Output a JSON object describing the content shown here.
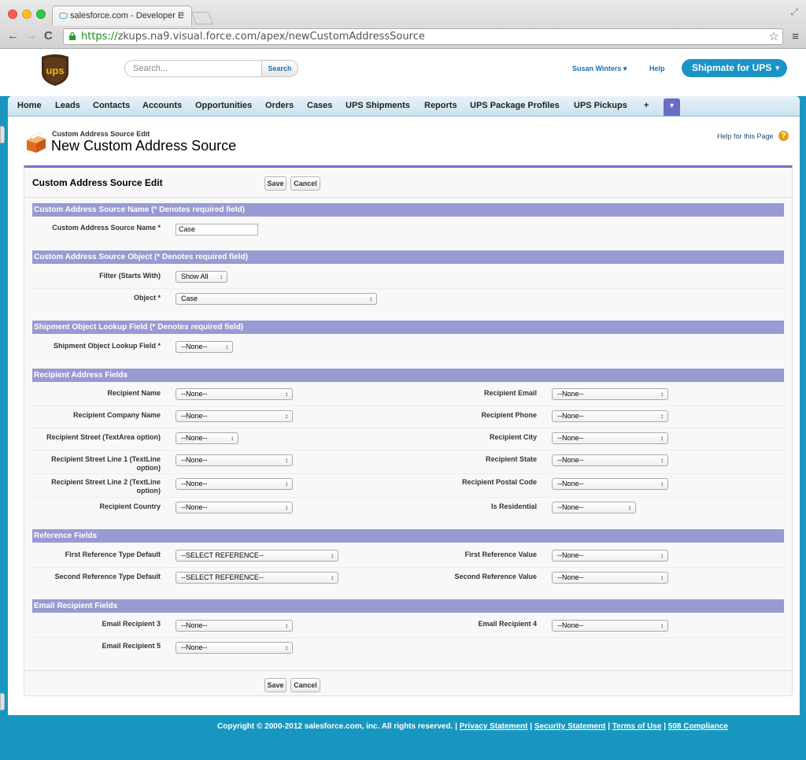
{
  "browser": {
    "tab_title": "salesforce.com - Developer E",
    "tab_close": "×",
    "url_scheme": "https://",
    "url_rest": "zkups.na9.visual.force.com/apex/newCustomAddressSource",
    "back": "←",
    "forward": "→",
    "reload": "C",
    "star": "☆",
    "menu": "≡",
    "resize": "⤢"
  },
  "header": {
    "search_placeholder": "Search...",
    "search_button": "Search",
    "user": "Susan Winters ▾",
    "help": "Help",
    "app_menu": "Shipmate for UPS",
    "app_caret": "▾"
  },
  "nav_tabs": [
    "Home",
    "Leads",
    "Contacts",
    "Accounts",
    "Opportunities",
    "Orders",
    "Cases",
    "UPS Shipments",
    "Reports",
    "UPS Package Profiles",
    "UPS Pickups",
    "+"
  ],
  "nav_more": "▾",
  "page": {
    "breadcrumb": "Custom Address Source Edit",
    "title": "New Custom Address Source",
    "help_link": "Help for this Page",
    "help_icon": "?"
  },
  "form": {
    "title": "Custom Address Source Edit",
    "save": "Save",
    "cancel": "Cancel",
    "sections": {
      "name": "Custom Address Source Name (* Denotes required field)",
      "object": "Custom Address Source Object (* Denotes required field)",
      "lookup": "Shipment Object Lookup Field (* Denotes required field)",
      "recipient": "Recipient Address Fields",
      "reference": "Reference Fields",
      "email": "Email Recipient Fields"
    },
    "name_label": "Custom Address Source Name *",
    "name_value": "Case",
    "filter_label": "Filter (Starts With)",
    "filter_value": "Show All",
    "object_label": "Object *",
    "object_value": "Case",
    "lookup_label": "Shipment Object Lookup Field *",
    "lookup_value": "--None--",
    "recipient_left": [
      {
        "label": "Recipient Name",
        "value": "--None--"
      },
      {
        "label": "Recipient Company Name",
        "value": "--None--"
      },
      {
        "label": "Recipient Street (TextArea option)",
        "value": "--None--"
      },
      {
        "label": "Recipient Street Line 1 (TextLine option)",
        "value": "--None--"
      },
      {
        "label": "Recipient Street Line 2 (TextLine option)",
        "value": "--None--"
      },
      {
        "label": "Recipient Country",
        "value": "--None--"
      }
    ],
    "recipient_right": [
      {
        "label": "Recipient Email",
        "value": "--None--"
      },
      {
        "label": "Recipient Phone",
        "value": "--None--"
      },
      {
        "label": "Recipient City",
        "value": "--None--"
      },
      {
        "label": "Recipient State",
        "value": "--None--"
      },
      {
        "label": "Recipient Postal Code",
        "value": "--None--"
      },
      {
        "label": "Is Residential",
        "value": "--None--"
      }
    ],
    "reference_left": [
      {
        "label": "First Reference Type Default",
        "value": "--SELECT REFERENCE--"
      },
      {
        "label": "Second Reference Type Default",
        "value": "--SELECT REFERENCE--"
      }
    ],
    "reference_right": [
      {
        "label": "First Reference Value",
        "value": "--None--"
      },
      {
        "label": "Second Reference Value",
        "value": "--None--"
      }
    ],
    "email_left": [
      {
        "label": "Email Recipient 3",
        "value": "--None--"
      },
      {
        "label": "Email Recipient 5",
        "value": "--None--"
      }
    ],
    "email_right": [
      {
        "label": "Email Recipient 4",
        "value": "--None--"
      }
    ]
  },
  "footer": {
    "copyright": "Copyright © 2000-2012 salesforce.com, inc. All rights reserved. |",
    "links": [
      "Privacy Statement",
      "Security Statement",
      "Terms of Use",
      "508 Compliance"
    ],
    "sep": "|"
  }
}
